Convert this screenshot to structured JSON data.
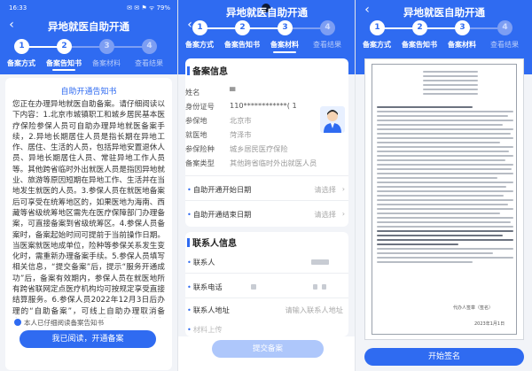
{
  "app": {
    "title": "异地就医自助开通",
    "status_time": "16:33",
    "status_icons": "✉ ✉ ⚑ ᯤ 79%"
  },
  "steps": [
    {
      "num": "1",
      "label": "备案方式"
    },
    {
      "num": "2",
      "label": "备案告知书"
    },
    {
      "num": "3",
      "label": "备案材料"
    },
    {
      "num": "4",
      "label": "查看结果"
    }
  ],
  "screen1": {
    "notice_title": "自助开通告知书",
    "notice_body": "您正在办理异地就医自助备案。请仔细阅读以下内容：1.北京市城镇职工和城乡居民基本医疗保险参保人员可自助办理异地就医备案手续，2.异地长期居住人员是指长期在异地工作、居住、生活的人员，包括异地安置退休人员、异地长期居住人员、常驻异地工作人员等。其他跨省临时外出就医人员是指因异地就业、旅游等原因短期在异地工作、生活并在当地发生就医的人员。3.参保人员在就医地备案后可享受在统筹地区的，如果医地为海南、西藏等省级统筹地区需先在医疗保障部门办理备案，可直接备案到省级统筹区。4.参保人员备案时，备案起始时间可提前于当前操作日期。当医案就医地成单位，险种等参保关系发生变化时，需重新办理备案手续。5.参保人员填写相关信息，“提交备案”后，提示“服务开通成功”后，备案有效期内，参保人员在就医地所有跨省联网定点医疗机构均可按规定享受直接结算服务。6.参保人员2022年12月3日后办理的“自助备案”，可线上自助办理取消备案；2022年12月3日前、线上办理的“快速备案”，需到参保经办机构线下办理取消备案。7.参保人员就医后，应主动表明异地就医身份，并主动出示医保电子凭证或社保卡。",
    "agree_text": "本人已仔细阅读备案告知书",
    "button_label": "我已阅读，开通备案"
  },
  "screen2": {
    "section1_title": "备案信息",
    "fields": [
      {
        "label": "姓名",
        "value": "▀"
      },
      {
        "label": "身份证号",
        "value": "110************( 1"
      },
      {
        "label": "参保地",
        "value": "北京市"
      },
      {
        "label": "就医地",
        "value": "菏泽市"
      },
      {
        "label": "参保险种",
        "value": "城乡居民医疗保险"
      },
      {
        "label": "备案类型",
        "value": "其他跨省临时外出就医人员"
      }
    ],
    "start_date_label": "自助开通开始日期",
    "end_date_label": "自助开通结束日期",
    "date_hint": "请选择",
    "section2_title": "联系人信息",
    "contact_label": "联系人",
    "contact_phone_label": "联系电话",
    "contact_addr_label": "联系人地址",
    "contact_addr_placeholder": "请输入联系人地址",
    "more_label": "材料上传",
    "submit_label": "提交备案"
  },
  "screen3": {
    "sign_label": "开始签名",
    "doc_sign_name": "代办人签章（签名）",
    "doc_date": "2023年1月1日"
  },
  "colors": {
    "primary": "#2f6bf1",
    "disabled": "#aec7fb"
  }
}
